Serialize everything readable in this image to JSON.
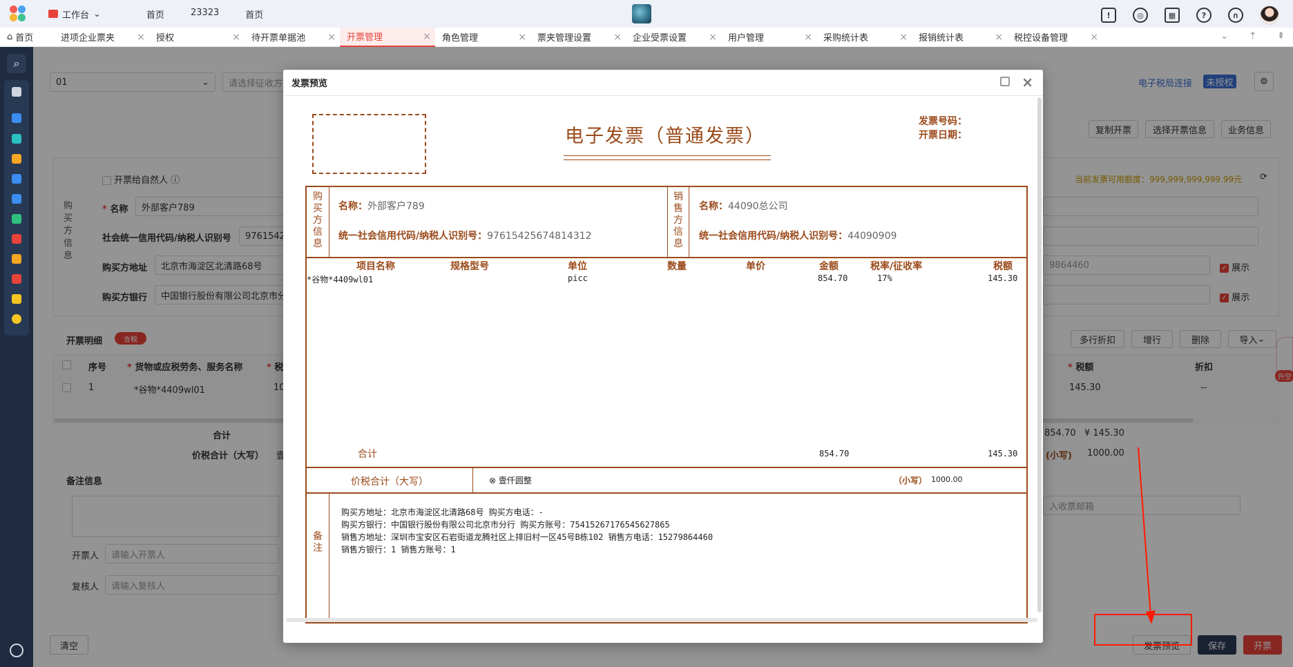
{
  "topbar": {
    "workspace": "工作台",
    "nav": [
      "首页",
      "23323",
      "首页"
    ]
  },
  "tabs": [
    {
      "label": "首页",
      "closable": false
    },
    {
      "label": "进项企业票夹",
      "closable": true
    },
    {
      "label": "授权",
      "closable": true
    },
    {
      "label": "待开票单据池",
      "closable": true
    },
    {
      "label": "开票管理",
      "closable": true,
      "active": true
    },
    {
      "label": "角色管理",
      "closable": true
    },
    {
      "label": "票夹管理设置",
      "closable": true
    },
    {
      "label": "企业受票设置",
      "closable": true
    },
    {
      "label": "用户管理",
      "closable": true
    },
    {
      "label": "采购统计表",
      "closable": true
    },
    {
      "label": "报销统计表",
      "closable": true
    },
    {
      "label": "税控设备管理",
      "closable": true
    }
  ],
  "background": {
    "select_value": "01",
    "select_placeholder": "请选择征收方",
    "tax_status": "电子税局连接",
    "auth_badge": "未授权",
    "buttons_top": [
      "复制开票",
      "选择开票信息",
      "业务信息"
    ],
    "issue_to_person": "开票给自然人",
    "buyer_section": "购买方信息",
    "name_label": "名称",
    "name_value": "外部客户789",
    "credit_label": "社会统一信用代码/纳税人识别号",
    "credit_value": "97615425",
    "address_label": "购买方地址",
    "address_value": "北京市海淀区北清路68号",
    "bank_label": "购买方银行",
    "bank_value": "中国银行股份有限公司北京市分",
    "quota": "当前发票可用额度：999,999,999,999.99元",
    "right_input_partial": "9864460",
    "show_label": "展示",
    "detail_label": "开票明细",
    "tax_toggle": "含税",
    "detail_buttons": [
      "多行折扣",
      "增行",
      "删除",
      "导入"
    ],
    "table_headers": [
      "序号",
      "货物或应税劳务、服务名称",
      "税",
      "税额",
      "折扣"
    ],
    "row": {
      "no": "1",
      "name": "*谷物*4409wl01",
      "partial": "10",
      "tax": "145.30",
      "discount": "--"
    },
    "total_label": "合计",
    "total_amount": "854.70",
    "total_tax": "¥ 145.30",
    "total_cap_label": "价税合计（大写）",
    "total_cap_partial": "壹",
    "small_label": "(小写)",
    "small_value": "1000.00",
    "remark_label": "备注信息",
    "email_placeholder": "入收票邮箱",
    "drawer_label": "开票人",
    "drawer_placeholder": "请输入开票人",
    "reviewer_label": "复核人",
    "reviewer_placeholder": "请输入复核人",
    "clear_btn": "清空",
    "preview_btn": "发票预览",
    "save_btn": "保存",
    "issue_btn": "开票",
    "side_float": "升空"
  },
  "modal": {
    "title": "发票预览",
    "invoice_title": "电子发票（普通发票）",
    "invoice_no_label": "发票号码：",
    "invoice_date_label": "开票日期：",
    "buyer_vlabel": "购买方信息",
    "seller_vlabel": "销售方信息",
    "name_key": "名称：",
    "credit_key": "统一社会信用代码/纳税人识别号：",
    "buyer_name": "外部客户789",
    "buyer_credit": "97615425674814312",
    "seller_name": "44090总公司",
    "seller_credit": "44090909",
    "columns": [
      "项目名称",
      "规格型号",
      "单位",
      "数量",
      "单价",
      "金额",
      "税率/征收率",
      "税额"
    ],
    "item": {
      "name": "*谷物*4409wl01",
      "spec": "",
      "unit": "picc",
      "qty": "",
      "price": "",
      "amount": "854.70",
      "rate": "17%",
      "tax": "145.30"
    },
    "sum_label": "合计",
    "sum_amount": "854.70",
    "sum_tax": "145.30",
    "cap_label": "价税合计（大写）",
    "cap_value": "壹仟圆整",
    "small_label": "（小写）",
    "small_value": "1000.00",
    "remark_vlabel": "备注",
    "remarks": [
      "购买方地址：北京市海淀区北清路68号 购买方电话：-",
      "购买方银行：中国银行股份有限公司北京市分行 购买方账号：75415267176545627865",
      "销售方地址：深圳市宝安区石岩街道龙腾社区上排旧村一区45号B栋102 销售方电话：15279864460",
      "销售方银行：1 销售方账号：1"
    ]
  },
  "colors": {
    "accent": "#e8433a",
    "invoice_brown": "#9a4a1a",
    "sidebar": "#1e2b40",
    "annotation_red": "#ff1a00"
  }
}
